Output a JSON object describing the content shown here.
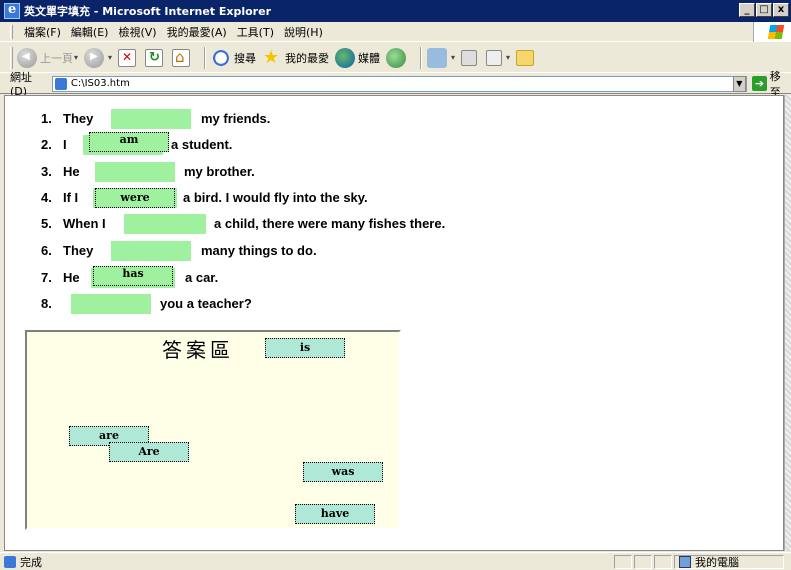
{
  "window": {
    "title": "英文單字填充 - Microsoft Internet Explorer",
    "min": "_",
    "max": "□",
    "close": "x"
  },
  "menu": [
    "檔案(F)",
    "編輯(E)",
    "檢視(V)",
    "我的最愛(A)",
    "工具(T)",
    "說明(H)"
  ],
  "toolbar": {
    "back": "上一頁",
    "search": "搜尋",
    "favorites": "我的最愛",
    "media": "媒體"
  },
  "address": {
    "label": "網址(D)",
    "value": "C:\\IS03.htm",
    "go": "移至"
  },
  "questions": [
    {
      "num": "1.",
      "before": "They",
      "answer": "",
      "after": "my friends."
    },
    {
      "num": "2.",
      "before": "I",
      "answer": "am",
      "after": "a student."
    },
    {
      "num": "3.",
      "before": "He",
      "answer": "",
      "after": "my brother."
    },
    {
      "num": "4.",
      "before": "If I",
      "answer": "were",
      "after": "a bird. I would fly into the sky."
    },
    {
      "num": "5.",
      "before": "When I",
      "answer": "",
      "after": "a child, there were many fishes there."
    },
    {
      "num": "6.",
      "before": "They",
      "answer": "",
      "after": "many things to do."
    },
    {
      "num": "7.",
      "before": "He",
      "answer": "has",
      "after": "a car."
    },
    {
      "num": "8.",
      "before": "",
      "answer": "",
      "after": "you a teacher?"
    }
  ],
  "answer_area": {
    "title": "答案區",
    "chips": [
      "is",
      "are",
      "Are",
      "was",
      "have"
    ]
  },
  "status": {
    "text": "完成",
    "zone": "我的電腦"
  }
}
